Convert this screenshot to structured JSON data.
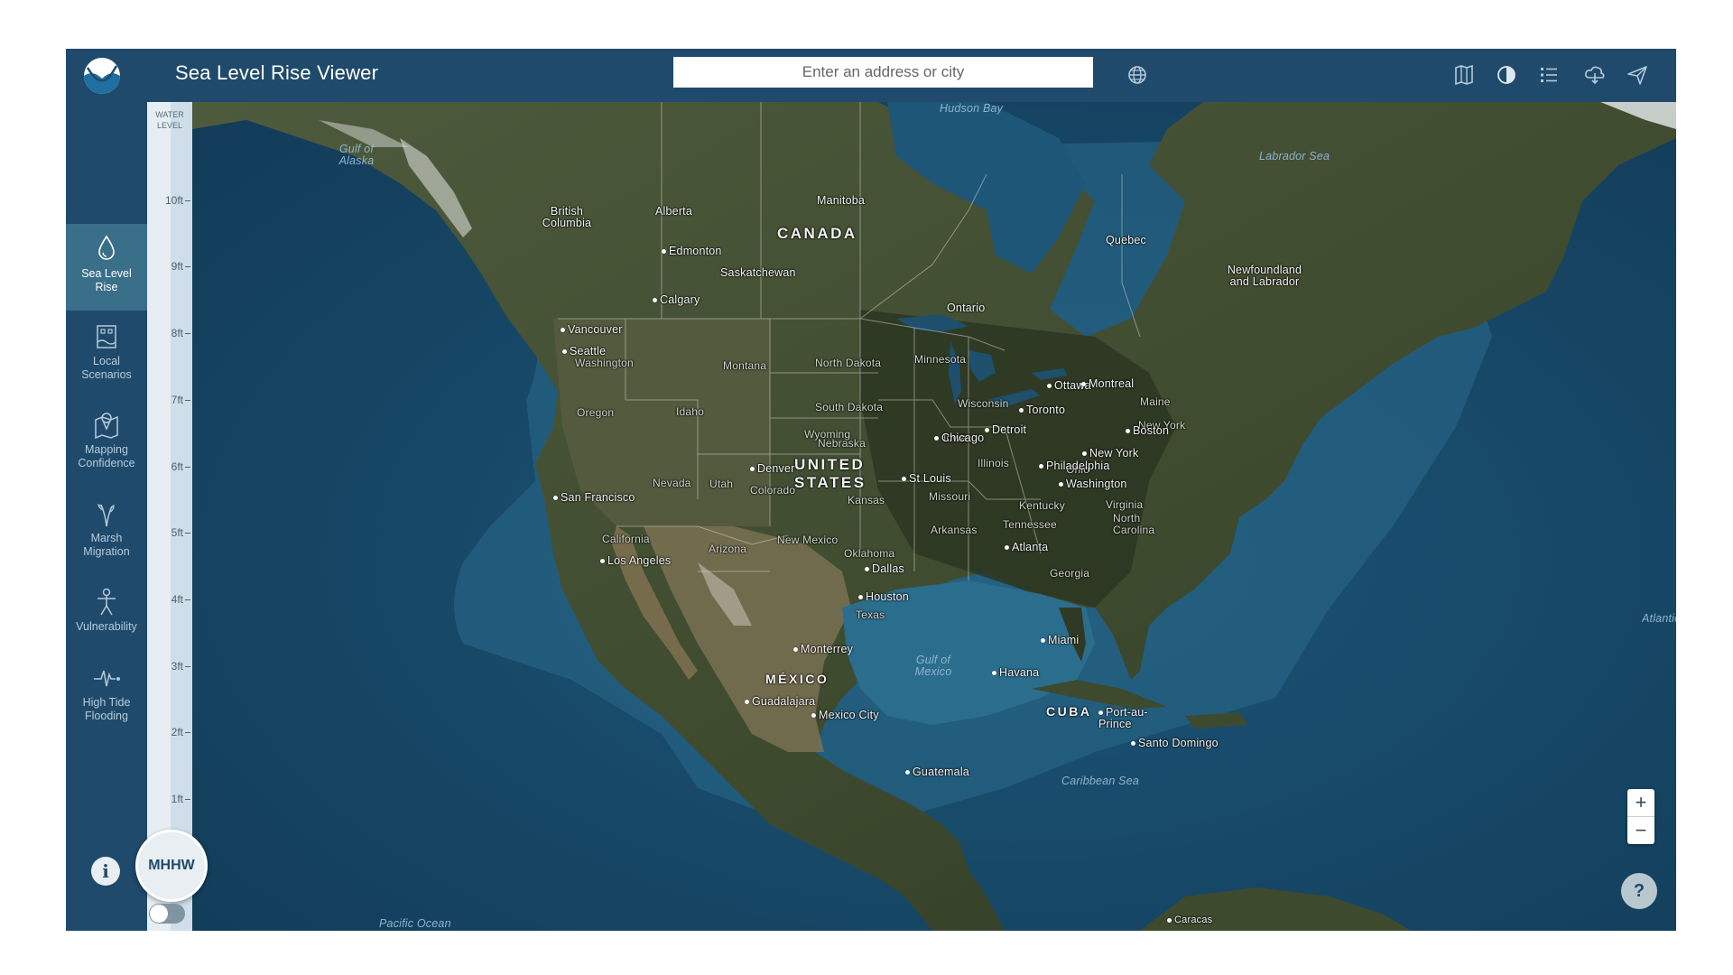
{
  "header": {
    "title": "Sea Level Rise Viewer",
    "search_placeholder": "Enter an address or city"
  },
  "sidebar": {
    "items": [
      {
        "label": "Sea Level Rise",
        "icon": "water-drop-icon",
        "active": true
      },
      {
        "label": "Local Scenarios",
        "icon": "local-scenarios-icon",
        "active": false
      },
      {
        "label": "Mapping Confidence",
        "icon": "mapping-confidence-icon",
        "active": false
      },
      {
        "label": "Marsh Migration",
        "icon": "marsh-plant-icon",
        "active": false
      },
      {
        "label": "Vulnerability",
        "icon": "person-icon",
        "active": false
      },
      {
        "label": "High Tide Flooding",
        "icon": "pulse-wave-icon",
        "active": false
      }
    ],
    "info_label": "i"
  },
  "slider": {
    "title": "WATER LEVEL",
    "ticks": [
      "10ft",
      "9ft",
      "8ft",
      "7ft",
      "6ft",
      "5ft",
      "4ft",
      "3ft",
      "2ft",
      "1ft"
    ],
    "current_label": "MHHW"
  },
  "map": {
    "countries": [
      "CANADA",
      "UNITED STATES",
      "MÉXICO",
      "CUBA"
    ],
    "provinces": [
      "British Columbia",
      "Alberta",
      "Saskatchewan",
      "Manitoba",
      "Ontario",
      "Quebec",
      "Newfoundland and Labrador"
    ],
    "states": [
      "Washington",
      "Oregon",
      "California",
      "Nevada",
      "Idaho",
      "Montana",
      "Wyoming",
      "Utah",
      "Arizona",
      "Colorado",
      "New Mexico",
      "North Dakota",
      "South Dakota",
      "Nebraska",
      "Kansas",
      "Oklahoma",
      "Texas",
      "Minnesota",
      "Iowa",
      "Missouri",
      "Arkansas",
      "Wisconsin",
      "Illinois",
      "Ohio",
      "Kentucky",
      "Tennessee",
      "Georgia",
      "Virginia",
      "North Carolina",
      "New York"
    ],
    "cities": [
      "Vancouver",
      "Seattle",
      "Edmonton",
      "Calgary",
      "San Francisco",
      "Los Angeles",
      "Denver",
      "Dallas",
      "Houston",
      "Monterrey",
      "Guadalajara",
      "Mexico City",
      "Guatemala",
      "Chicago",
      "Detroit",
      "Toronto",
      "Ottawa",
      "Montreal",
      "Boston",
      "New York",
      "Philadelphia",
      "Washington",
      "Atlanta",
      "Miami",
      "Havana",
      "Port-au-Prince",
      "Santo Domingo",
      "St Louis",
      "Maine",
      "Caracas"
    ],
    "water": [
      "Hudson Bay",
      "Gulf of Alaska",
      "Labrador Sea",
      "Gulf of Mexico",
      "Caribbean Sea",
      "Pacific Ocean",
      "Atlantic Ocean"
    ]
  },
  "zoom": {
    "in": "+",
    "out": "−"
  },
  "help_label": "?",
  "colors": {
    "header": "#1f4a6b",
    "active_tab": "#3a6f8a",
    "ocean": "#174766"
  }
}
